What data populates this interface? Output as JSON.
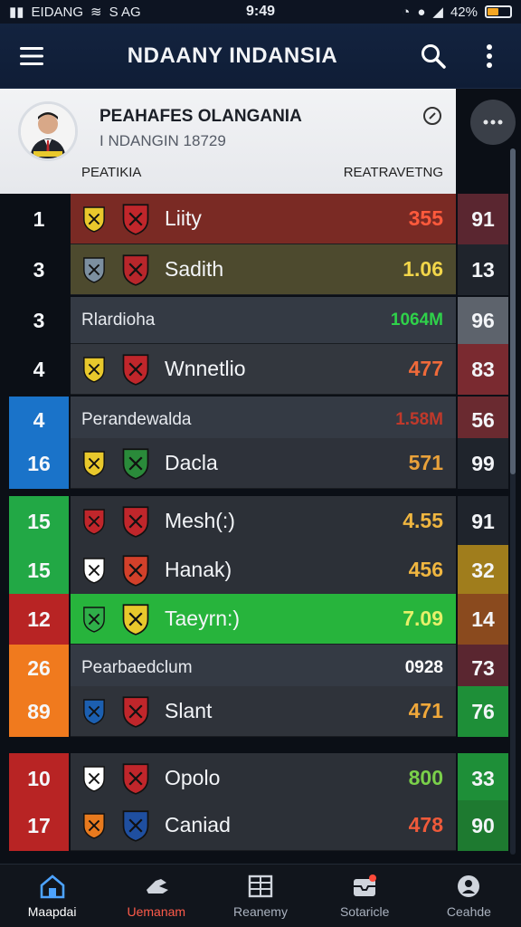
{
  "status_bar": {
    "carrier": "EIDANG",
    "left_extra": "S  AG",
    "time": "9:49",
    "battery": "42%"
  },
  "app_bar": {
    "title": "NDAANY INDANSIA",
    "icons": [
      "menu-icon",
      "search-icon",
      "more-vertical-icon"
    ]
  },
  "profile": {
    "name": "PEAHAFES OLANGANIA",
    "subtitle": "I NDANGIN 18729",
    "left_heading": "PEATIKIA",
    "right_heading": "REATRAVETNG"
  },
  "rows": [
    {
      "rank": "1",
      "name": "Liity",
      "value": "355",
      "side": "91",
      "cell_bg": "#7a2a24",
      "value_color": "#ff5a3c",
      "rank_bg": "#0b0f16",
      "side_bg": "#5a2630"
    },
    {
      "rank": "3",
      "name": "Sadith",
      "value": "1.06",
      "side": "13",
      "cell_bg": "#4d4a2e",
      "value_color": "#f2d64a",
      "rank_bg": "#0b0f16",
      "side_bg": "#1f242c"
    },
    {
      "rank": "4",
      "name": "Wnnetlio",
      "value": "477",
      "side": "83",
      "cell_bg": "#33373e",
      "value_color": "#ef6a3a",
      "rank_bg": "#0b0f16",
      "side_bg": "#7a2a30"
    },
    {
      "rank": "16",
      "name": "Dacla",
      "value": "571",
      "side": "99",
      "cell_bg": "#2e323a",
      "value_color": "#e9a13a",
      "rank_bg": "#1a73c9",
      "side_bg": "#1f242c"
    },
    {
      "rank": "15",
      "name": "Mesh(:)",
      "value": "4.55",
      "side": "91",
      "cell_bg": "#2c3037",
      "value_color": "#f0b640",
      "rank_bg": "#22a845",
      "side_bg": "#1f242c"
    },
    {
      "rank": "15",
      "name": "Hanak)",
      "value": "456",
      "side": "32",
      "cell_bg": "#2c3037",
      "value_color": "#f0b640",
      "rank_bg": "#22a845",
      "side_bg": "#a07d1c"
    },
    {
      "rank": "12",
      "name": "Taeyrn:)",
      "value": "7.09",
      "side": "14",
      "cell_bg": "#27b43c",
      "value_color": "#e6f06a",
      "rank_bg": "#b82424",
      "side_bg": "#8a4a1e"
    },
    {
      "rank": "89",
      "name": "Slant",
      "value": "471",
      "side": "76",
      "cell_bg": "#2f333a",
      "value_color": "#f0a83a",
      "rank_bg": "#f07a1e",
      "side_bg": "#1e8f38"
    },
    {
      "rank": "10",
      "name": "Opolo",
      "value": "800",
      "side": "33",
      "cell_bg": "#2c3037",
      "value_color": "#7ad04a",
      "rank_bg": "#b82424",
      "side_bg": "#1e8f38"
    },
    {
      "rank": "17",
      "name": "Caniad",
      "value": "478",
      "side": "90",
      "cell_bg": "#2c3037",
      "value_color": "#ef5a3a",
      "rank_bg": "#b82424",
      "side_bg": "#1e7a30"
    }
  ],
  "groups": [
    {
      "rank": "3",
      "title": "Rlardioha",
      "value": "1064M",
      "side": "96",
      "value_color": "#2fd14a",
      "rank_bg": "#0b0f16",
      "side_bg": "#5d636c"
    },
    {
      "rank": "4",
      "title": "Perandewalda",
      "value": "1.58M",
      "side": "56",
      "value_color": "#c0392b",
      "rank_bg": "#1a73c9",
      "side_bg": "#6a2a30"
    },
    {
      "rank": "26",
      "title": "Pearbaedclum",
      "value": "0928",
      "side": "73",
      "value_color": "#ffffff",
      "rank_bg": "#f07a1e",
      "side_bg": "#5a2630"
    }
  ],
  "extra_ranks": {
    "row_16_top": "4",
    "row_15_top": "15"
  },
  "nav": [
    {
      "label": "Maapdai",
      "icon": "home-icon"
    },
    {
      "label": "Uemanam",
      "icon": "shoe-icon"
    },
    {
      "label": "Reanemy",
      "icon": "grid-icon"
    },
    {
      "label": "Sotaricle",
      "icon": "inbox-icon"
    },
    {
      "label": "Ceahde",
      "icon": "profile-icon"
    }
  ]
}
